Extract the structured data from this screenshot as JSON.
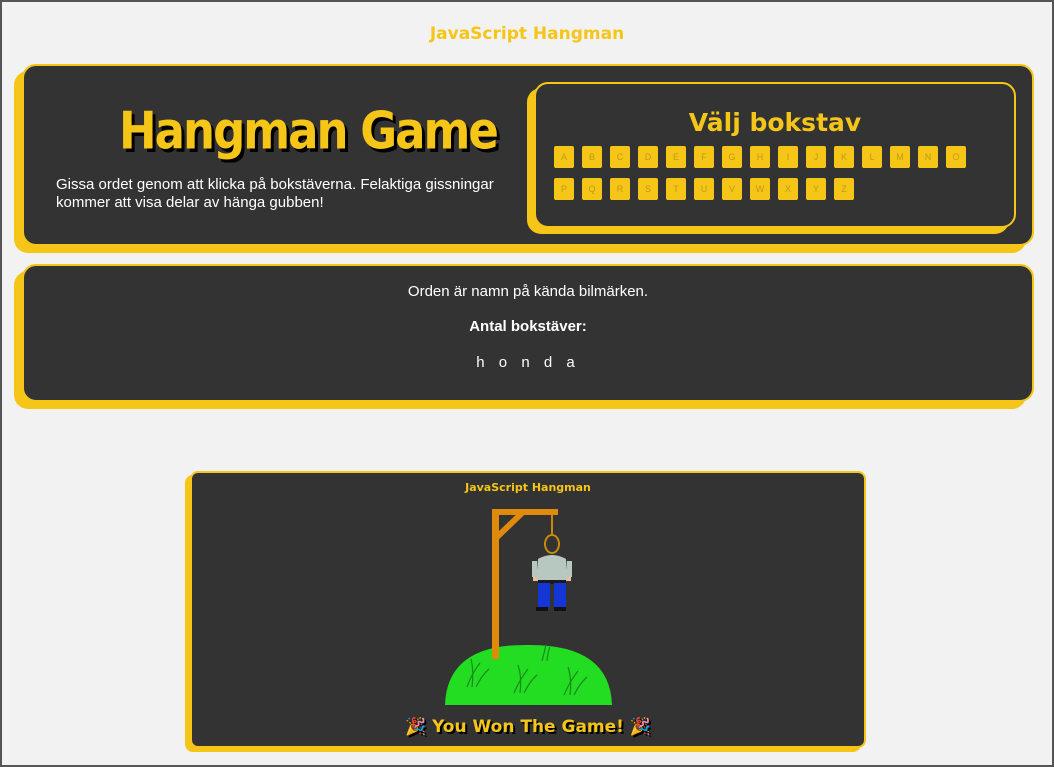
{
  "page": {
    "title": "JavaScript Hangman"
  },
  "hero": {
    "title": "Hangman Game",
    "intro": "Gissa ordet genom att klicka på bokstäverna. Felaktiga gissningar kommer att visa delar av hänga gubben!"
  },
  "letters": {
    "title": "Välj bokstav",
    "items": [
      "A",
      "B",
      "C",
      "D",
      "E",
      "F",
      "G",
      "H",
      "I",
      "J",
      "K",
      "L",
      "M",
      "N",
      "O",
      "P",
      "Q",
      "R",
      "S",
      "T",
      "U",
      "V",
      "W",
      "X",
      "Y",
      "Z"
    ]
  },
  "word_panel": {
    "hint": "Orden är namn på kända bilmärken.",
    "count_label": "Antal bokstäver:",
    "word": "honda"
  },
  "game": {
    "title": "JavaScript Hangman",
    "win_message": "You Won The Game!",
    "win_icon": "party-popper-icon",
    "colors": {
      "gallows": "#e08a0b",
      "hill": "#22dd22",
      "accent": "#f5c518"
    }
  }
}
